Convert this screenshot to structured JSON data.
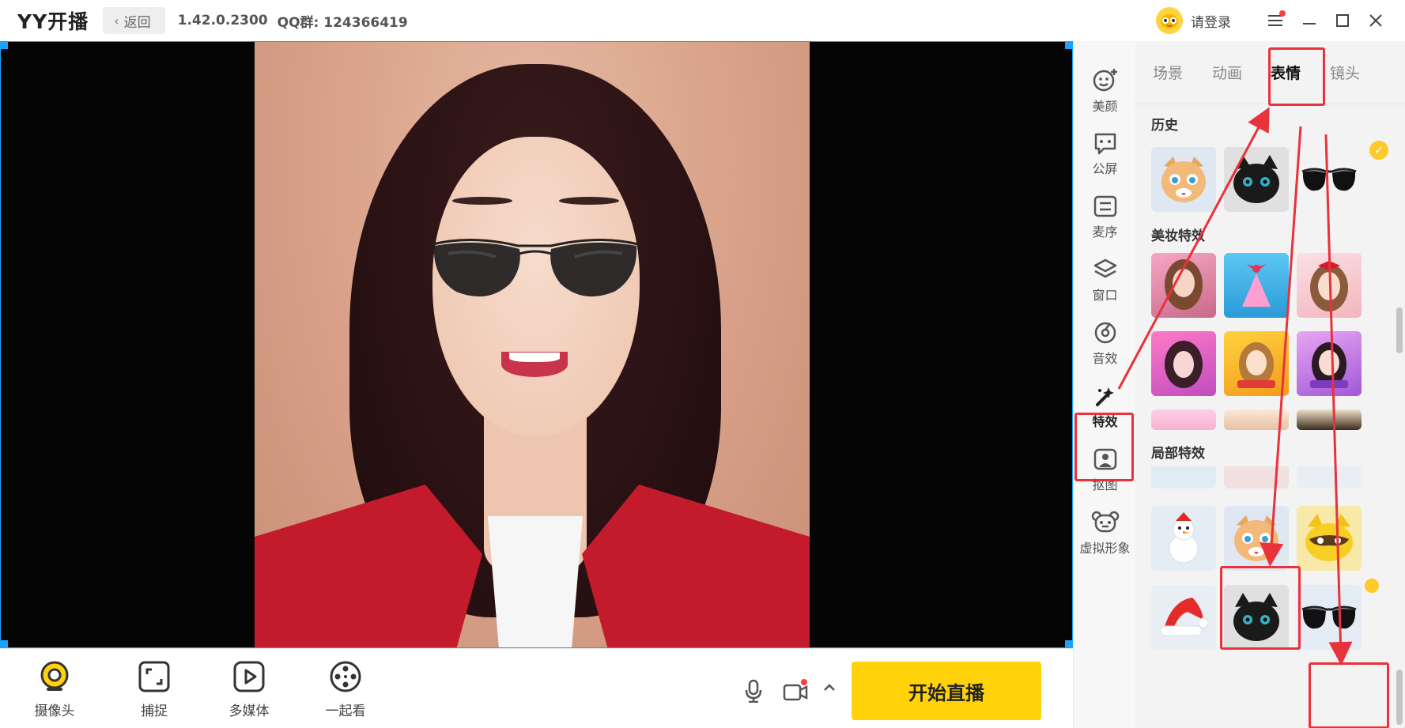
{
  "app": {
    "logo": "YY开播",
    "back_label": "返回",
    "version": "1.42.0.2300",
    "qq_group": "QQ群: 124366419",
    "login_label": "请登录"
  },
  "bottom_tools": [
    {
      "label": "摄像头",
      "icon": "camera-icon"
    },
    {
      "label": "捕捉",
      "icon": "capture-icon"
    },
    {
      "label": "多媒体",
      "icon": "media-play-icon"
    },
    {
      "label": "一起看",
      "icon": "film-reel-icon"
    }
  ],
  "start_button_label": "开始直播",
  "side_nav": [
    {
      "label": "美颜",
      "icon": "beauty-face-icon"
    },
    {
      "label": "公屏",
      "icon": "chat-bubble-icon"
    },
    {
      "label": "麦序",
      "icon": "list-icon"
    },
    {
      "label": "窗口",
      "icon": "layers-icon"
    },
    {
      "label": "音效",
      "icon": "sound-effect-icon"
    },
    {
      "label": "特效",
      "icon": "magic-wand-icon"
    },
    {
      "label": "抠图",
      "icon": "portrait-cutout-icon"
    },
    {
      "label": "虚拟形象",
      "icon": "avatar-bear-icon"
    }
  ],
  "active_side_nav": "特效",
  "effect_tabs": [
    "场景",
    "动画",
    "表情",
    "镜头"
  ],
  "active_effect_tab": "表情",
  "sections": {
    "history": "历史",
    "makeup": "美妆特效",
    "local": "局部特效"
  },
  "accent_colors": {
    "primary_yellow": "#ffd20a",
    "highlight_red": "#e8323c",
    "selection_blue": "#1aa3ff",
    "check_gold": "#ffc928"
  }
}
